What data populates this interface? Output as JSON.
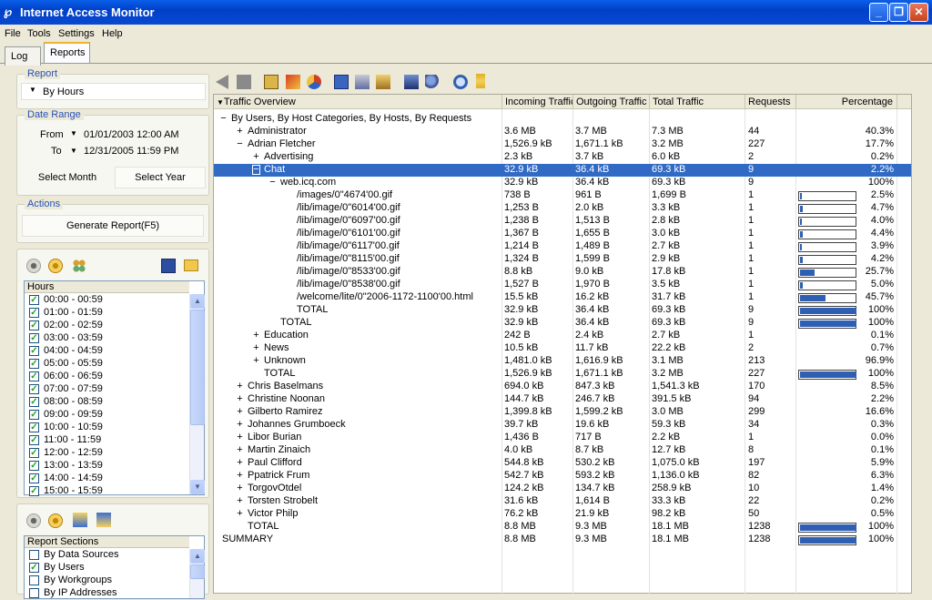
{
  "window": {
    "title": "Internet Access Monitor"
  },
  "menu": [
    "File",
    "Tools",
    "Settings",
    "Help"
  ],
  "tabs": [
    "Log",
    "Reports"
  ],
  "report": {
    "title": "Report",
    "selected": "By Hours"
  },
  "date_range": {
    "title": "Date Range",
    "from_label": "From",
    "to_label": "To",
    "from_value": "01/01/2003 12:00 AM",
    "to_value": "12/31/2005 11:59 PM",
    "select_month": "Select Month",
    "select_year": "Select Year"
  },
  "actions": {
    "title": "Actions",
    "generate": "Generate Report(F5)"
  },
  "hours": {
    "header": "Hours",
    "items": [
      "00:00 - 00:59",
      "01:00 - 01:59",
      "02:00 - 02:59",
      "03:00 - 03:59",
      "04:00 - 04:59",
      "05:00 - 05:59",
      "06:00 - 06:59",
      "07:00 - 07:59",
      "08:00 - 08:59",
      "09:00 - 09:59",
      "10:00 - 10:59",
      "11:00 - 11:59",
      "12:00 - 12:59",
      "13:00 - 13:59",
      "14:00 - 14:59",
      "15:00 - 15:59"
    ]
  },
  "sections": {
    "header": "Report Sections",
    "items": [
      {
        "label": "By Data Sources",
        "checked": false
      },
      {
        "label": "By Users",
        "checked": true
      },
      {
        "label": "By Workgroups",
        "checked": false
      },
      {
        "label": "By IP Addresses",
        "checked": false
      }
    ]
  },
  "grid": {
    "columns": [
      "Traffic Overview",
      "Incoming Traffic",
      "Outgoing Traffic",
      "Total Traffic",
      "Requests",
      "Percentage"
    ],
    "rows": [
      {
        "l": 0,
        "x": "−",
        "n": "By Users, By Host Categories, By Hosts, By Requests",
        "i": "",
        "o": "",
        "t": "",
        "r": "",
        "p": "",
        "b": null
      },
      {
        "l": 1,
        "x": "+",
        "n": "Administrator",
        "i": "3.6 MB",
        "o": "3.7 MB",
        "t": "7.3 MB",
        "r": "44",
        "p": "40.3%",
        "b": null
      },
      {
        "l": 1,
        "x": "−",
        "n": "Adrian Fletcher",
        "i": "1,526.9 kB",
        "o": "1,671.1 kB",
        "t": "3.2 MB",
        "r": "227",
        "p": "17.7%",
        "b": null
      },
      {
        "l": 2,
        "x": "+",
        "n": "Advertising",
        "i": "2.3 kB",
        "o": "3.7 kB",
        "t": "6.0 kB",
        "r": "2",
        "p": "0.2%",
        "b": null
      },
      {
        "l": 2,
        "x": "−",
        "n": "Chat",
        "i": "32.9 kB",
        "o": "36.4 kB",
        "t": "69.3 kB",
        "r": "9",
        "p": "2.2%",
        "b": null,
        "sel": true
      },
      {
        "l": 3,
        "x": "−",
        "n": "web.icq.com",
        "i": "32.9 kB",
        "o": "36.4 kB",
        "t": "69.3 kB",
        "r": "9",
        "p": "100%",
        "b": null
      },
      {
        "l": 4,
        "x": "",
        "n": "/images/0\"4674'00.gif",
        "i": "738 B",
        "o": "961 B",
        "t": "1,699 B",
        "r": "1",
        "p": "2.5%",
        "b": 0.025
      },
      {
        "l": 4,
        "x": "",
        "n": "/lib/image/0\"6014'00.gif",
        "i": "1,253 B",
        "o": "2.0 kB",
        "t": "3.3 kB",
        "r": "1",
        "p": "4.7%",
        "b": 0.047
      },
      {
        "l": 4,
        "x": "",
        "n": "/lib/image/0\"6097'00.gif",
        "i": "1,238 B",
        "o": "1,513 B",
        "t": "2.8 kB",
        "r": "1",
        "p": "4.0%",
        "b": 0.04
      },
      {
        "l": 4,
        "x": "",
        "n": "/lib/image/0\"6101'00.gif",
        "i": "1,367 B",
        "o": "1,655 B",
        "t": "3.0 kB",
        "r": "1",
        "p": "4.4%",
        "b": 0.044
      },
      {
        "l": 4,
        "x": "",
        "n": "/lib/image/0\"6117'00.gif",
        "i": "1,214 B",
        "o": "1,489 B",
        "t": "2.7 kB",
        "r": "1",
        "p": "3.9%",
        "b": 0.039
      },
      {
        "l": 4,
        "x": "",
        "n": "/lib/image/0\"8115'00.gif",
        "i": "1,324 B",
        "o": "1,599 B",
        "t": "2.9 kB",
        "r": "1",
        "p": "4.2%",
        "b": 0.042
      },
      {
        "l": 4,
        "x": "",
        "n": "/lib/image/0\"8533'00.gif",
        "i": "8.8 kB",
        "o": "9.0 kB",
        "t": "17.8 kB",
        "r": "1",
        "p": "25.7%",
        "b": 0.257
      },
      {
        "l": 4,
        "x": "",
        "n": "/lib/image/0\"8538'00.gif",
        "i": "1,527 B",
        "o": "1,970 B",
        "t": "3.5 kB",
        "r": "1",
        "p": "5.0%",
        "b": 0.05
      },
      {
        "l": 4,
        "x": "",
        "n": "/welcome/lite/0\"2006-1172-1100'00.html",
        "i": "15.5 kB",
        "o": "16.2 kB",
        "t": "31.7 kB",
        "r": "1",
        "p": "45.7%",
        "b": 0.457
      },
      {
        "l": 4,
        "x": "",
        "n": "TOTAL",
        "i": "32.9 kB",
        "o": "36.4 kB",
        "t": "69.3 kB",
        "r": "9",
        "p": "100%",
        "b": 1
      },
      {
        "l": 3,
        "x": "",
        "n": "TOTAL",
        "i": "32.9 kB",
        "o": "36.4 kB",
        "t": "69.3 kB",
        "r": "9",
        "p": "100%",
        "b": 1
      },
      {
        "l": 2,
        "x": "+",
        "n": "Education",
        "i": "242 B",
        "o": "2.4 kB",
        "t": "2.7 kB",
        "r": "1",
        "p": "0.1%",
        "b": null
      },
      {
        "l": 2,
        "x": "+",
        "n": "News",
        "i": "10.5 kB",
        "o": "11.7 kB",
        "t": "22.2 kB",
        "r": "2",
        "p": "0.7%",
        "b": null
      },
      {
        "l": 2,
        "x": "+",
        "n": "Unknown",
        "i": "1,481.0 kB",
        "o": "1,616.9 kB",
        "t": "3.1 MB",
        "r": "213",
        "p": "96.9%",
        "b": null
      },
      {
        "l": 2,
        "x": "",
        "n": "TOTAL",
        "i": "1,526.9 kB",
        "o": "1,671.1 kB",
        "t": "3.2 MB",
        "r": "227",
        "p": "100%",
        "b": 1
      },
      {
        "l": 1,
        "x": "+",
        "n": "Chris Baselmans",
        "i": "694.0 kB",
        "o": "847.3 kB",
        "t": "1,541.3 kB",
        "r": "170",
        "p": "8.5%",
        "b": null
      },
      {
        "l": 1,
        "x": "+",
        "n": "Christine Noonan",
        "i": "144.7 kB",
        "o": "246.7 kB",
        "t": "391.5 kB",
        "r": "94",
        "p": "2.2%",
        "b": null
      },
      {
        "l": 1,
        "x": "+",
        "n": "Gilberto Ramirez",
        "i": "1,399.8 kB",
        "o": "1,599.2 kB",
        "t": "3.0 MB",
        "r": "299",
        "p": "16.6%",
        "b": null
      },
      {
        "l": 1,
        "x": "+",
        "n": "Johannes Grumboeck",
        "i": "39.7 kB",
        "o": "19.6 kB",
        "t": "59.3 kB",
        "r": "34",
        "p": "0.3%",
        "b": null
      },
      {
        "l": 1,
        "x": "+",
        "n": "Libor Burian",
        "i": "1,436 B",
        "o": "717 B",
        "t": "2.2 kB",
        "r": "1",
        "p": "0.0%",
        "b": null
      },
      {
        "l": 1,
        "x": "+",
        "n": "Martin Zinaich",
        "i": "4.0 kB",
        "o": "8.7 kB",
        "t": "12.7 kB",
        "r": "8",
        "p": "0.1%",
        "b": null
      },
      {
        "l": 1,
        "x": "+",
        "n": "Paul Clifford",
        "i": "544.8 kB",
        "o": "530.2 kB",
        "t": "1,075.0 kB",
        "r": "197",
        "p": "5.9%",
        "b": null
      },
      {
        "l": 1,
        "x": "+",
        "n": "Ppatrick Frum",
        "i": "542.7 kB",
        "o": "593.2 kB",
        "t": "1,136.0 kB",
        "r": "82",
        "p": "6.3%",
        "b": null
      },
      {
        "l": 1,
        "x": "+",
        "n": "TorgovOtdel",
        "i": "124.2 kB",
        "o": "134.7 kB",
        "t": "258.9 kB",
        "r": "10",
        "p": "1.4%",
        "b": null
      },
      {
        "l": 1,
        "x": "+",
        "n": "Torsten Strobelt",
        "i": "31.6 kB",
        "o": "1,614 B",
        "t": "33.3 kB",
        "r": "22",
        "p": "0.2%",
        "b": null
      },
      {
        "l": 1,
        "x": "+",
        "n": "Victor Philp",
        "i": "76.2 kB",
        "o": "21.9 kB",
        "t": "98.2 kB",
        "r": "50",
        "p": "0.5%",
        "b": null
      },
      {
        "l": 1,
        "x": "",
        "n": "TOTAL",
        "i": "8.8 MB",
        "o": "9.3 MB",
        "t": "18.1 MB",
        "r": "1238",
        "p": "100%",
        "b": 1
      },
      {
        "l": 0,
        "x": "",
        "n": "SUMMARY",
        "i": "8.8 MB",
        "o": "9.3 MB",
        "t": "18.1 MB",
        "r": "1238",
        "p": "100%",
        "b": 1
      }
    ]
  },
  "colors": {
    "selection": "#316ac5",
    "bar_fill": "#2f5fb3",
    "title_bar": "#0a48d0",
    "group_title": "#2650b5"
  }
}
